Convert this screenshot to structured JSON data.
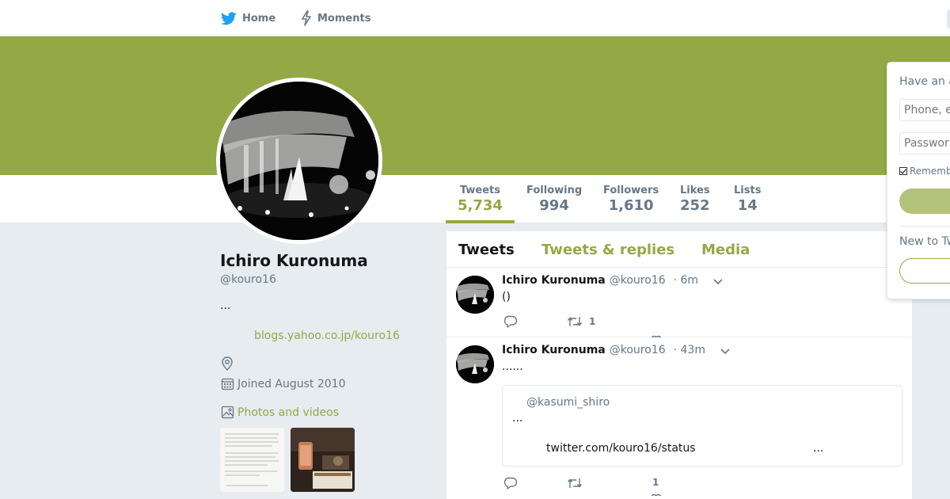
{
  "nav": {
    "home_label": "Home",
    "moments_label": "Moments",
    "home_icon": "bird-icon",
    "moments_icon": "lightning-icon"
  },
  "theme": {
    "accent": "#94a845",
    "text": "#14171a",
    "muted": "#657786",
    "background": "#e6ecf0"
  },
  "stats": {
    "tweets": {
      "label": "Tweets",
      "value": "5,734"
    },
    "following": {
      "label": "Following",
      "value": "994"
    },
    "followers": {
      "label": "Followers",
      "value": "1,610"
    },
    "likes": {
      "label": "Likes",
      "value": "252"
    },
    "lists": {
      "label": "Lists",
      "value": "14"
    }
  },
  "profile": {
    "name": "Ichiro Kuronuma",
    "handle": "@kouro16",
    "bio": "...",
    "url": "blogs.yahoo.co.jp/kouro16",
    "joined": "Joined August 2010",
    "photos_label": "Photos and videos"
  },
  "tabs": {
    "tweets": "Tweets",
    "replies": "Tweets & replies",
    "media": "Media"
  },
  "tweets": [
    {
      "name": "Ichiro Kuronuma",
      "handle": "@kouro16",
      "time": "· 6m",
      "text": "()",
      "retweets": "1"
    },
    {
      "name": "Ichiro Kuronuma",
      "handle": "@kouro16",
      "time": "· 43m",
      "text": "......",
      "quote": {
        "handle": "@kasumi_shiro",
        "text": "...",
        "link": "twitter.com/kouro16/status",
        "ellipsis": "..."
      },
      "likes": "1"
    }
  ],
  "login": {
    "title": "Have an a",
    "phone_placeholder": "Phone, e",
    "password_placeholder": "Passwor",
    "remember": "Rememb",
    "new_title": "New to Tw"
  }
}
